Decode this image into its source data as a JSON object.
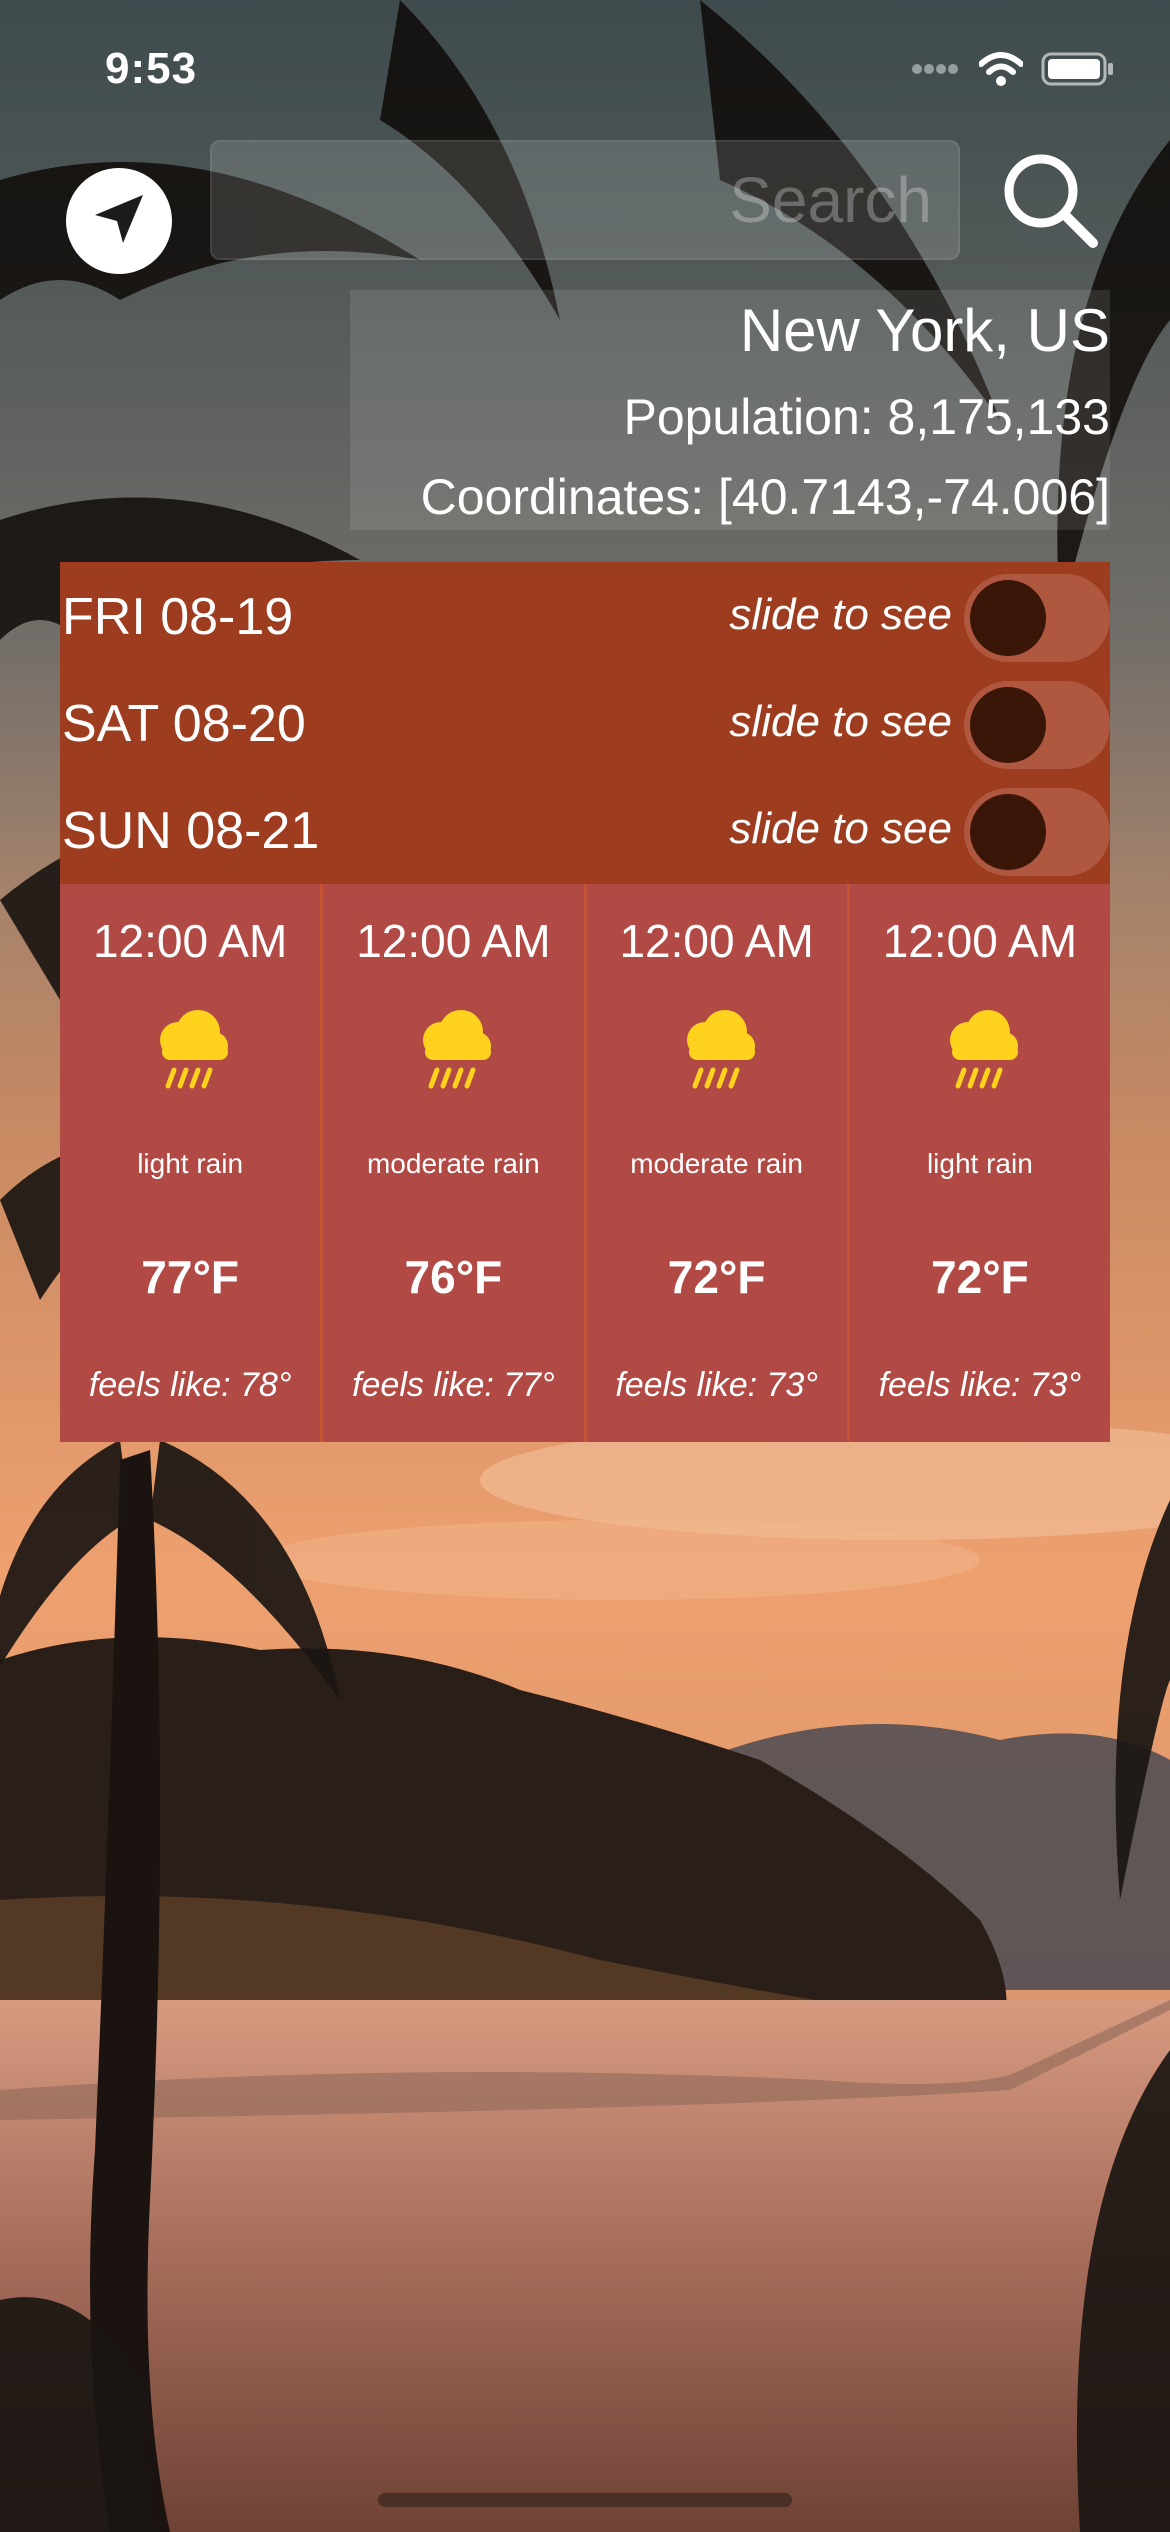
{
  "status_bar": {
    "time": "9:53"
  },
  "search": {
    "placeholder": "Search",
    "value": ""
  },
  "icons": {
    "location": "location-arrow-icon",
    "search": "search-icon",
    "weather": "rain-cloud-icon",
    "wifi": "wifi-icon",
    "battery": "battery-icon",
    "signal": "cellular-signal-icon"
  },
  "city": {
    "name": "New York, US",
    "population": "Population: 8,175,133",
    "coordinates": "Coordinates: [40.7143,-74.006]"
  },
  "days": [
    {
      "label": "FRI 08-19",
      "hint": "slide to see",
      "toggle_on": false
    },
    {
      "label": "SAT 08-20",
      "hint": "slide to see",
      "toggle_on": false
    },
    {
      "label": "SUN 08-21",
      "hint": "slide to see",
      "toggle_on": false
    }
  ],
  "hours": [
    {
      "time": "12:00 AM",
      "desc": "light rain",
      "temp": "77°F",
      "feels": "feels like: 78°"
    },
    {
      "time": "12:00 AM",
      "desc": "moderate rain",
      "temp": "76°F",
      "feels": "feels like: 77°"
    },
    {
      "time": "12:00 AM",
      "desc": "moderate rain",
      "temp": "72°F",
      "feels": "feels like: 73°"
    },
    {
      "time": "12:00 AM",
      "desc": "light rain",
      "temp": "72°F",
      "feels": "feels like: 73°"
    }
  ],
  "colors": {
    "days_bg": "#9e3c1f",
    "hours_bg": "#b14a45",
    "toggle_knob": "#3a1608",
    "icon_yellow": "#ffd21e"
  }
}
